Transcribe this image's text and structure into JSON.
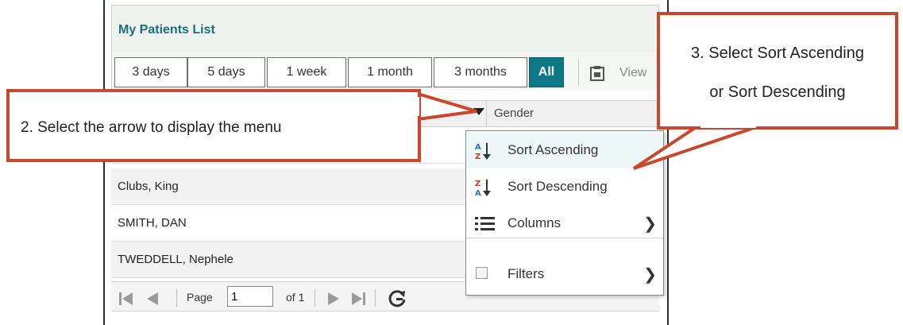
{
  "panel": {
    "title": "My Patients List",
    "range_buttons": [
      "3 days",
      "5 days",
      "1 week",
      "1 month",
      "3 months",
      "All"
    ],
    "active_range": "All",
    "view_label": "View"
  },
  "grid": {
    "columns": {
      "gender": "Gender"
    },
    "rows": [
      "Clubs, King",
      "SMITH, DAN",
      "TWEDDELL, Nephele"
    ]
  },
  "column_menu": {
    "items": [
      "Sort Ascending",
      "Sort Descending",
      "Columns",
      "Filters"
    ]
  },
  "pager": {
    "page_label": "Page",
    "page_value": "1",
    "of_label": "of 1"
  },
  "callouts": {
    "step2": "2. Select the arrow to display the menu",
    "step3_line1": "3. Select Sort Ascending",
    "step3_line2": "or Sort Descending"
  },
  "colors": {
    "accent": "#0f7886",
    "title": "#1a6f7d",
    "callout_border": "#c9472c"
  }
}
